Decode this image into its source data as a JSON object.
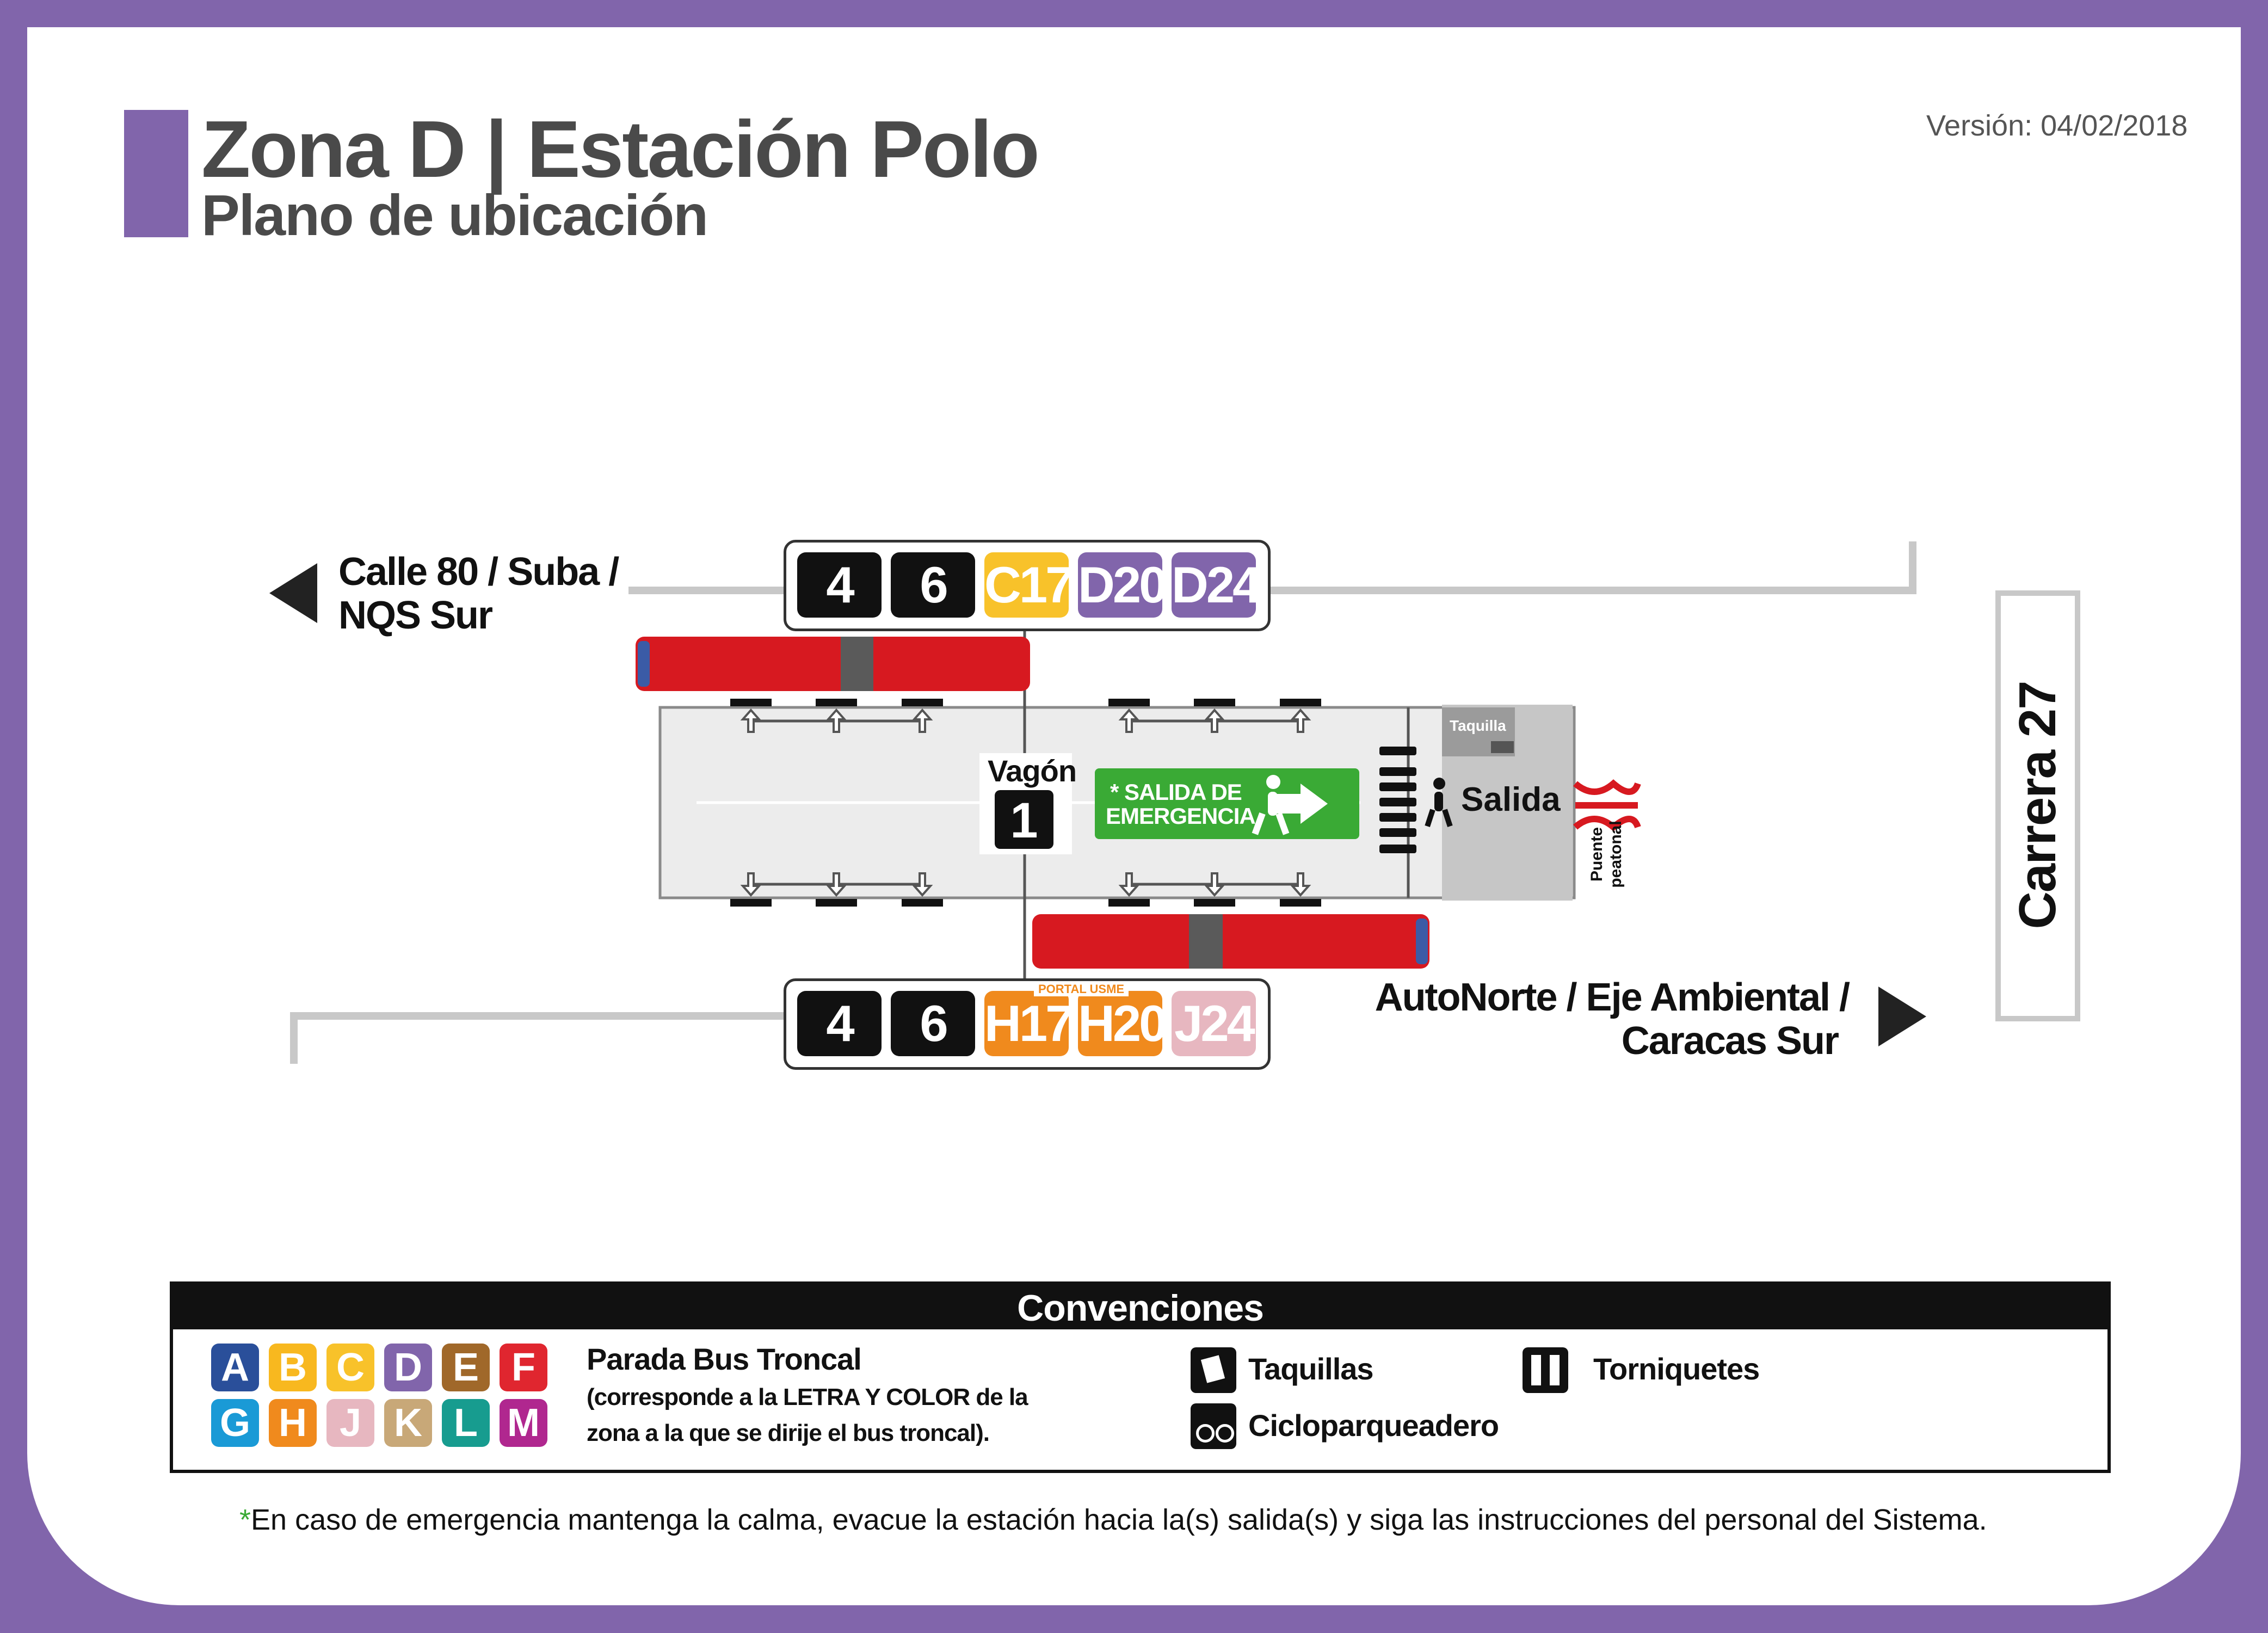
{
  "header": {
    "title": "Zona D | Estación Polo",
    "subtitle": "Plano de ubicación",
    "version": "Versión: 04/02/2018"
  },
  "directions": {
    "west_line1": "Calle 80 / Suba /",
    "west_line2": "NQS Sur",
    "east_line1": "AutoNorte / Eje Ambiental /",
    "east_line2": "Caracas Sur",
    "street": "Carrera 27"
  },
  "routes_top": [
    {
      "label": "4",
      "color": "#111111"
    },
    {
      "label": "6",
      "color": "#111111"
    },
    {
      "label": "C17",
      "color": "#f8c22a"
    },
    {
      "label": "D20",
      "color": "#8165ab"
    },
    {
      "label": "D24",
      "color": "#8165ab"
    }
  ],
  "routes_bottom": [
    {
      "label": "4",
      "color": "#111111"
    },
    {
      "label": "6",
      "color": "#111111"
    },
    {
      "label": "H17",
      "color": "#f08a1d"
    },
    {
      "label": "H20",
      "color": "#f08a1d"
    },
    {
      "label": "J24",
      "color": "#e7b7c0"
    }
  ],
  "portal_usme": "PORTAL USME",
  "station": {
    "wagon_label": "Vagón",
    "wagon_number": "1",
    "emergency_line1": "* SALIDA DE",
    "emergency_line2": "EMERGENCIA",
    "taquilla": "Taquilla",
    "salida": "Salida",
    "bridge_line1": "Puente",
    "bridge_line2": "peatonal"
  },
  "legend": {
    "title": "Convenciones",
    "letters_row1": [
      {
        "l": "A",
        "c": "#2a4f9a"
      },
      {
        "l": "B",
        "c": "#f8b81f"
      },
      {
        "l": "C",
        "c": "#f8c22a"
      },
      {
        "l": "D",
        "c": "#8165ab"
      },
      {
        "l": "E",
        "c": "#a0682a"
      },
      {
        "l": "F",
        "c": "#e0262f"
      }
    ],
    "letters_row2": [
      {
        "l": "G",
        "c": "#1a9ad6"
      },
      {
        "l": "H",
        "c": "#f08a1d"
      },
      {
        "l": "J",
        "c": "#e7b7c0"
      },
      {
        "l": "K",
        "c": "#c8a878"
      },
      {
        "l": "L",
        "c": "#179c8f"
      },
      {
        "l": "M",
        "c": "#b0278f"
      }
    ],
    "bus_title": "Parada Bus Troncal",
    "bus_desc1": "(corresponde a la LETRA Y COLOR de la",
    "bus_desc2": "zona a la que se dirije el bus troncal).",
    "taquillas": "Taquillas",
    "cicloparqueadero": "Cicloparqueadero",
    "torniquetes": "Torniquetes"
  },
  "footer": {
    "asterisk": "*",
    "note": "En caso de emergencia mantenga la calma, evacue la estación hacia la(s) salida(s) y siga las instrucciones del personal del Sistema."
  },
  "colors": {
    "frame": "#8165ab",
    "bus_red": "#d71920",
    "emergency_green": "#3aaa35",
    "platform_gray": "#c8c8c8",
    "bridge_red": "#d71920"
  }
}
